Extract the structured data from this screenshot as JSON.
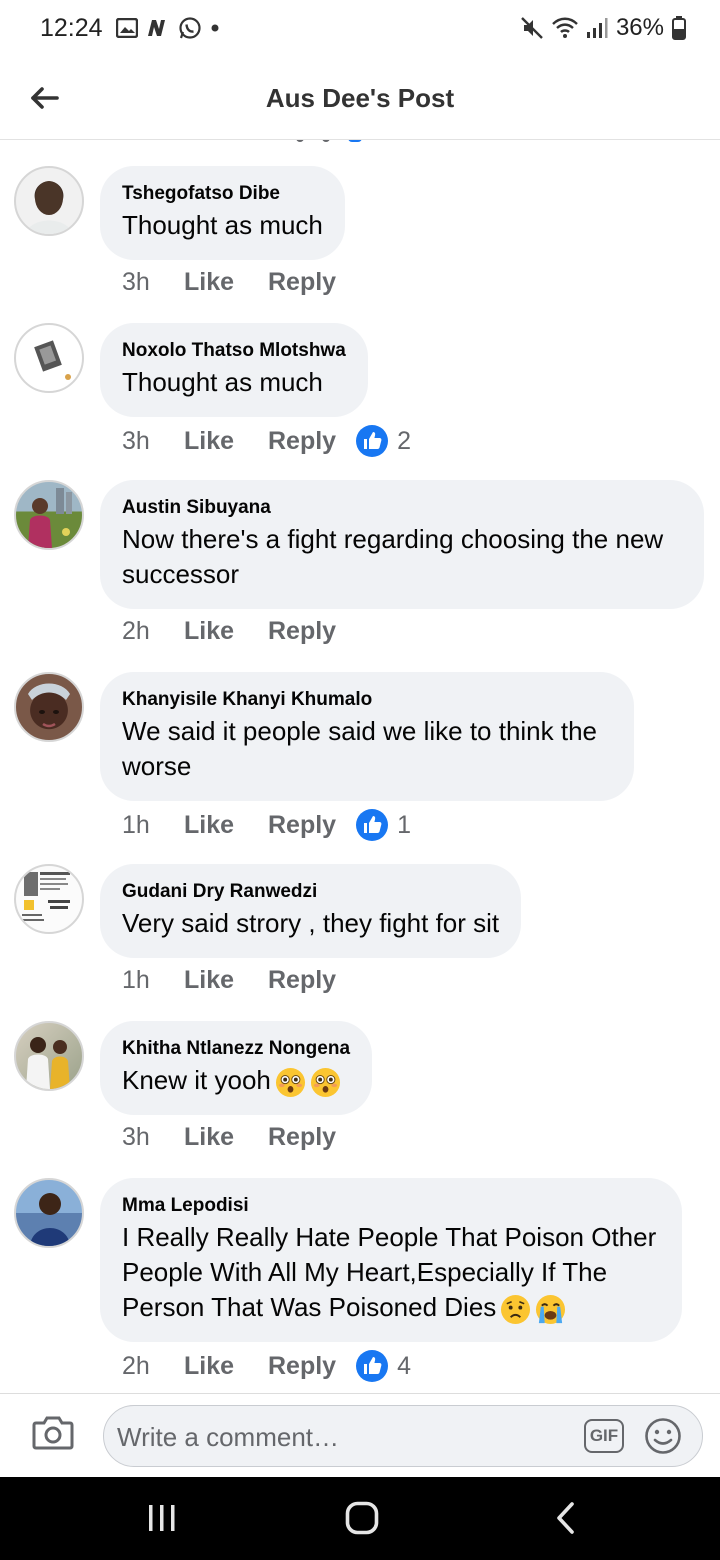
{
  "status_bar": {
    "time": "12:24",
    "battery": "36%",
    "icons": [
      "gallery-icon",
      "news-icon",
      "whatsapp-icon",
      "dot-icon",
      "mute-icon",
      "wifi-icon",
      "signal-icon",
      "battery-icon"
    ]
  },
  "header": {
    "title": "Aus Dee's Post",
    "back_icon": "arrow-left-icon"
  },
  "actions": {
    "like": "Like",
    "reply": "Reply"
  },
  "comments": [
    {
      "author": "Tshegofatso Dibe",
      "text": "Thought as much",
      "time": "3h",
      "reactions": null
    },
    {
      "author": "Noxolo Thatso Mlotshwa",
      "text": "Thought as much",
      "time": "3h",
      "reactions": "2"
    },
    {
      "author": "Austin Sibuyana",
      "text": "Now there's a fight regarding choosing the new successor",
      "time": "2h",
      "reactions": null
    },
    {
      "author": "Khanyisile Khanyi Khumalo",
      "text": "We said it people said we like to think the worse",
      "time": "1h",
      "reactions": "1"
    },
    {
      "author": "Gudani Dry Ranwedzi",
      "text": "Very said strory , they fight for sit",
      "time": "1h",
      "reactions": null
    },
    {
      "author": "Khitha Ntlanezz Nongena",
      "text": "Knew it yooh",
      "time": "3h",
      "reactions": null,
      "emojis": [
        "flushed-face-icon",
        "flushed-face-icon"
      ]
    },
    {
      "author": "Mma Lepodisi",
      "text": "I Really Really Hate People That Poison Other People With All My Heart,Especially If The Person That Was Poisoned Dies",
      "time": "2h",
      "reactions": "4",
      "emojis": [
        "worried-face-icon",
        "crying-face-icon"
      ]
    }
  ],
  "composer": {
    "placeholder": "Write a comment…",
    "gif_label": "GIF"
  },
  "colors": {
    "bubble": "#f0f2f5",
    "like_blue": "#1877f2",
    "secondary_text": "#65676b"
  }
}
